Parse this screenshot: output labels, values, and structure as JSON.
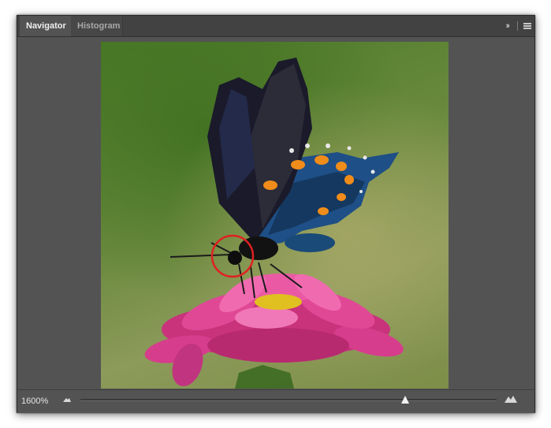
{
  "panel": {
    "tabs": [
      {
        "label": "Navigator",
        "active": true
      },
      {
        "label": "Histogram",
        "active": false
      }
    ],
    "collapse_icon": "double-chevron-right-icon",
    "menu_icon": "hamburger-menu-icon"
  },
  "preview": {
    "view_box_color": "#e02020"
  },
  "footer": {
    "zoom_value": "1600%",
    "zoom_out_icon": "small-mountain-icon",
    "zoom_in_icon": "large-mountain-icon",
    "zoom_slider_position": 0.78
  }
}
